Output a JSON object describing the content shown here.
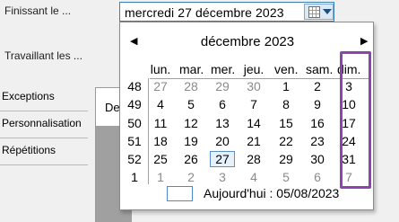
{
  "labels": {
    "finishing": "Finissant le ...",
    "working": "Travaillant les ..."
  },
  "side_tabs": [
    "Exceptions",
    "Personnalisation",
    "Répétitions"
  ],
  "panel_text": "De",
  "date_field": {
    "value": "mercredi 27 décembre 2023"
  },
  "calendar": {
    "month_title": "décembre 2023",
    "prev": "◀",
    "next": "▶",
    "day_names": [
      "lun.",
      "mar.",
      "mer.",
      "jeu.",
      "ven.",
      "sam.",
      "dim."
    ],
    "weeks": [
      {
        "num": "48",
        "days": [
          "27",
          "28",
          "29",
          "30",
          "1",
          "2",
          "3"
        ]
      },
      {
        "num": "49",
        "days": [
          "4",
          "5",
          "6",
          "7",
          "8",
          "9",
          "10"
        ]
      },
      {
        "num": "50",
        "days": [
          "11",
          "12",
          "13",
          "14",
          "15",
          "16",
          "17"
        ]
      },
      {
        "num": "51",
        "days": [
          "18",
          "19",
          "20",
          "21",
          "22",
          "23",
          "24"
        ]
      },
      {
        "num": "52",
        "days": [
          "25",
          "26",
          "27",
          "28",
          "29",
          "30",
          "31"
        ]
      },
      {
        "num": "1",
        "days": [
          "1",
          "2",
          "3",
          "4",
          "5",
          "6",
          "7"
        ]
      }
    ],
    "other_month": [
      [
        true,
        true,
        true,
        true,
        false,
        false,
        false
      ],
      [
        false,
        false,
        false,
        false,
        false,
        false,
        false
      ],
      [
        false,
        false,
        false,
        false,
        false,
        false,
        false
      ],
      [
        false,
        false,
        false,
        false,
        false,
        false,
        false
      ],
      [
        false,
        false,
        false,
        false,
        false,
        false,
        false
      ],
      [
        true,
        true,
        true,
        true,
        true,
        true,
        true
      ]
    ],
    "selected": {
      "week": 4,
      "day": 2
    },
    "today_label": "Aujourd'hui : 05/08/2023"
  },
  "colors": {
    "highlight": "#8e44ad",
    "accent": "#3c7fb1"
  },
  "icons": {
    "calendar": "calendar-icon",
    "dropdown": "dropdown-arrow-icon"
  }
}
